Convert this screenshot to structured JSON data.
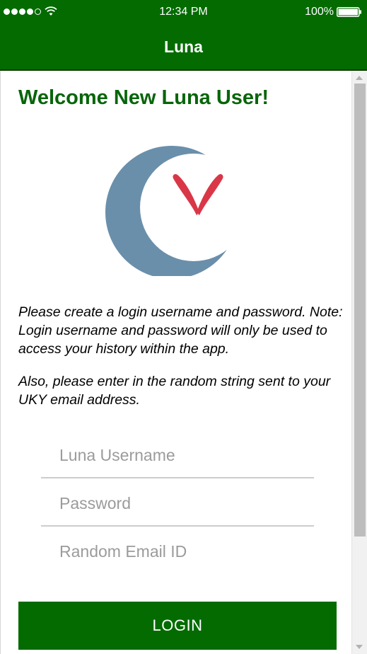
{
  "status_bar": {
    "time": "12:34 PM",
    "battery": "100%",
    "signal_icon": "signal-dots-icon",
    "wifi_icon": "wifi-icon",
    "battery_icon": "battery-icon"
  },
  "header": {
    "title": "Luna"
  },
  "welcome": {
    "heading": "Welcome New Luna User!"
  },
  "logo": {
    "icon": "luna-crescent-butterfly-logo",
    "moon_color": "#6a8fab",
    "butterfly_color": "#d93747"
  },
  "instructions": {
    "paragraph1": "Please create a login username and password. Note: Login username and password will only be used to access your history within the app.",
    "paragraph2": "Also, please enter in the random string sent to your UKY email address."
  },
  "form": {
    "username_placeholder": "Luna Username",
    "password_placeholder": "Password",
    "email_id_placeholder": "Random Email ID",
    "login_label": "LOGIN"
  },
  "colors": {
    "brand_green": "#036b00",
    "heading_green": "#07650a",
    "placeholder_gray": "#9b9b9b"
  }
}
